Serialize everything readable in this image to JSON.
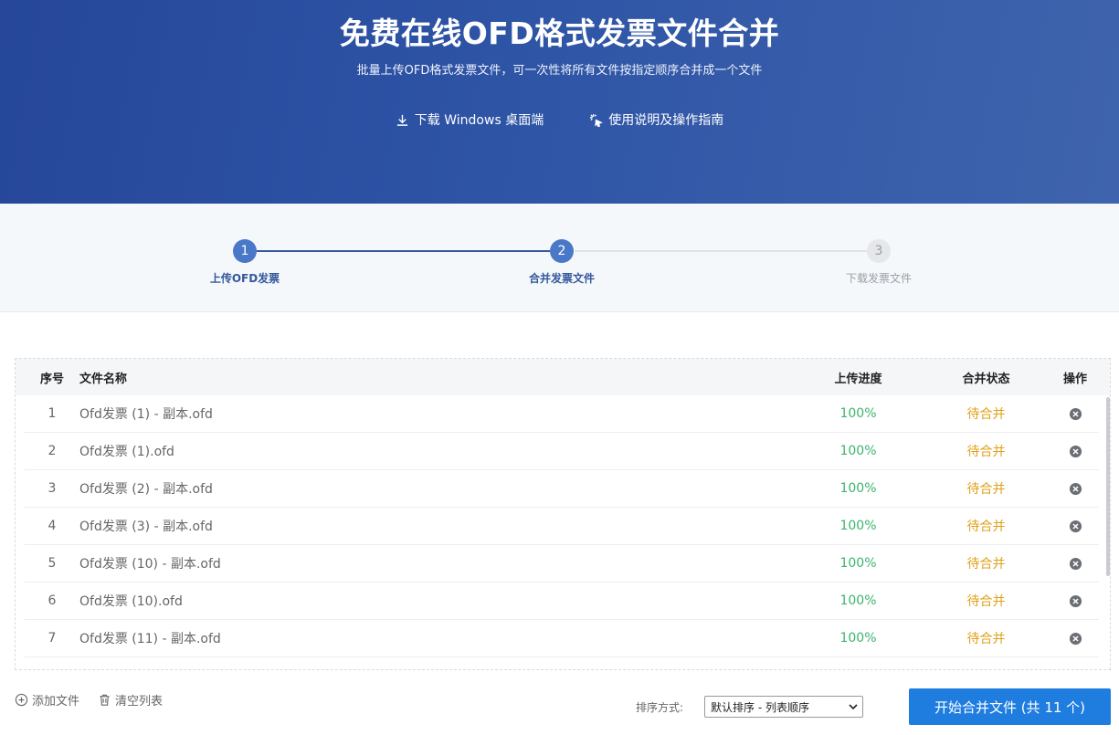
{
  "hero": {
    "title": "免费在线OFD格式发票文件合并",
    "subtitle": "批量上传OFD格式发票文件，可一次性将所有文件按指定顺序合并成一个文件",
    "download_link": "下载 Windows 桌面端",
    "guide_link": "使用说明及操作指南"
  },
  "steps": [
    {
      "num": "1",
      "label": "上传OFD发票",
      "state": "done"
    },
    {
      "num": "2",
      "label": "合并发票文件",
      "state": "active"
    },
    {
      "num": "3",
      "label": "下载发票文件",
      "state": "todo"
    }
  ],
  "table": {
    "headers": {
      "no": "序号",
      "name": "文件名称",
      "progress": "上传进度",
      "status": "合并状态",
      "action": "操作"
    },
    "rows": [
      {
        "no": "1",
        "name": "Ofd发票 (1) - 副本.ofd",
        "progress": "100%",
        "status": "待合并"
      },
      {
        "no": "2",
        "name": "Ofd发票 (1).ofd",
        "progress": "100%",
        "status": "待合并"
      },
      {
        "no": "3",
        "name": "Ofd发票 (2) - 副本.ofd",
        "progress": "100%",
        "status": "待合并"
      },
      {
        "no": "4",
        "name": "Ofd发票 (3) - 副本.ofd",
        "progress": "100%",
        "status": "待合并"
      },
      {
        "no": "5",
        "name": "Ofd发票 (10) - 副本.ofd",
        "progress": "100%",
        "status": "待合并"
      },
      {
        "no": "6",
        "name": "Ofd发票 (10).ofd",
        "progress": "100%",
        "status": "待合并"
      },
      {
        "no": "7",
        "name": "Ofd发票 (11) - 副本.ofd",
        "progress": "100%",
        "status": "待合并"
      }
    ]
  },
  "footer": {
    "add_file": "添加文件",
    "clear_list": "清空列表",
    "sort_label": "排序方式:",
    "sort_value": "默认排序 - 列表顺序",
    "merge_button": "开始合并文件 (共 11 个)"
  },
  "colors": {
    "hero_bg": "#2e54a6",
    "step_active": "#4a78c9",
    "progress_green": "#3cb46e",
    "status_orange": "#e0a21b",
    "button_blue": "#1f7de0"
  },
  "icons": {
    "download": "download-icon",
    "guide": "sparkle-cursor-icon",
    "remove": "close-circle-icon",
    "add": "plus-circle-icon",
    "clear": "trash-icon",
    "dropdown": "chevron-down-icon"
  }
}
